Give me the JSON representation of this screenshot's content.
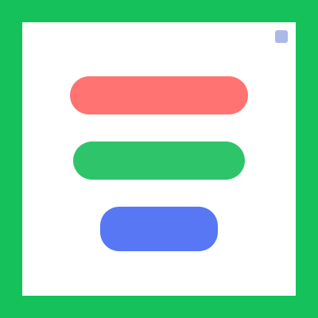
{
  "colors": {
    "frame": "#14c15a",
    "panel": "#ffffff",
    "red_button": "#ff7373",
    "green_button": "#2ec46a",
    "blue_button": "#5877f5",
    "corner_icon": "#aab9e8"
  },
  "panel": {
    "title": "",
    "corner_icon": "info-icon"
  },
  "buttons": {
    "red_label": "",
    "green_label": "",
    "blue_label": ""
  }
}
